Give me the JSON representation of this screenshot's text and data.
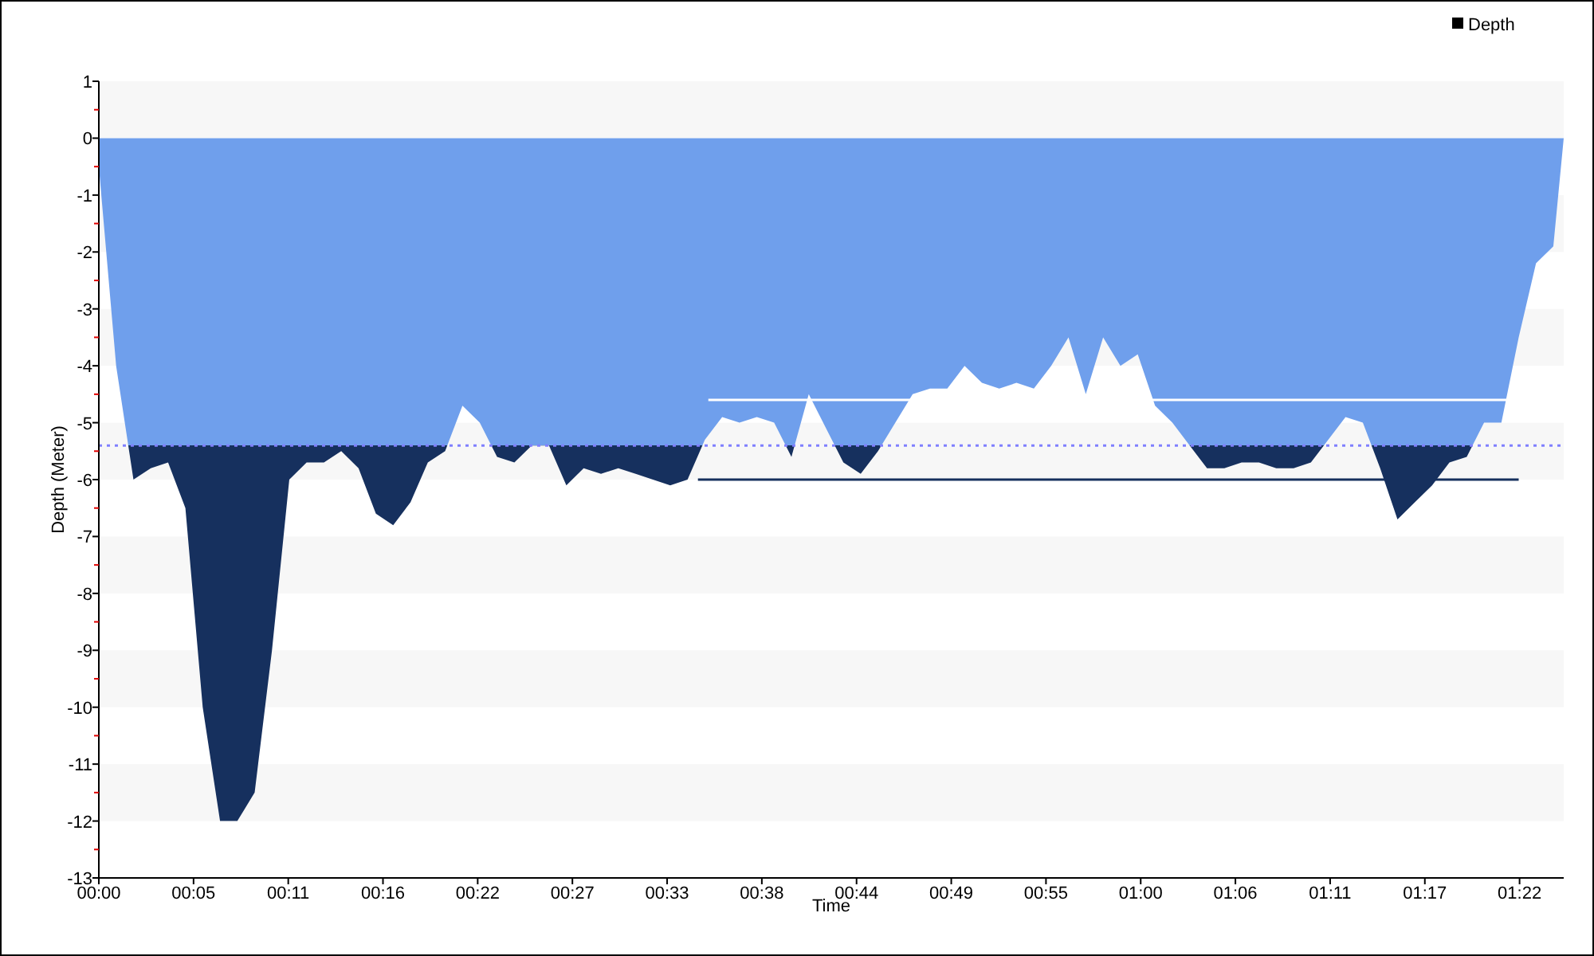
{
  "chart_data": {
    "type": "area",
    "xlabel": "Time",
    "ylabel": "Depth (Meter)",
    "xlim": [
      0,
      84.6
    ],
    "ylim": [
      -13,
      1
    ],
    "yticks": [
      1,
      0,
      -1,
      -2,
      -3,
      -4,
      -5,
      -6,
      -7,
      -8,
      -9,
      -10,
      -11,
      -12,
      -13
    ],
    "xticks": [
      {
        "value": 0,
        "label": "00:00"
      },
      {
        "value": 5.47,
        "label": "00:05"
      },
      {
        "value": 10.94,
        "label": "00:11"
      },
      {
        "value": 16.41,
        "label": "00:16"
      },
      {
        "value": 21.88,
        "label": "00:22"
      },
      {
        "value": 27.35,
        "label": "00:27"
      },
      {
        "value": 32.82,
        "label": "00:33"
      },
      {
        "value": 38.29,
        "label": "00:38"
      },
      {
        "value": 43.76,
        "label": "00:44"
      },
      {
        "value": 49.23,
        "label": "00:49"
      },
      {
        "value": 54.7,
        "label": "00:55"
      },
      {
        "value": 60.17,
        "label": "01:00"
      },
      {
        "value": 65.64,
        "label": "01:06"
      },
      {
        "value": 71.11,
        "label": "01:11"
      },
      {
        "value": 76.58,
        "label": "01:17"
      },
      {
        "value": 82.05,
        "label": "01:22"
      }
    ],
    "x": [
      0,
      1,
      2,
      3,
      4,
      5,
      6,
      7,
      8,
      9,
      10,
      11,
      12,
      13,
      14,
      15,
      16,
      17,
      18,
      19,
      20,
      21,
      22,
      23,
      24,
      25,
      26,
      27,
      28,
      29,
      30,
      31,
      32,
      33,
      34,
      35,
      36,
      37,
      38,
      39,
      40,
      41,
      42,
      43,
      44,
      45,
      46,
      47,
      48,
      49,
      50,
      51,
      52,
      53,
      54,
      55,
      56,
      57,
      58,
      59,
      60,
      61,
      62,
      63,
      64,
      65,
      66,
      67,
      68,
      69,
      70,
      71,
      72,
      73,
      74,
      75,
      76,
      77,
      78,
      79,
      80,
      81,
      82,
      83,
      84,
      84.6
    ],
    "series": [
      {
        "name": "Depth",
        "color": "#6f9fec",
        "values": [
          -0.5,
          -4,
          -6,
          -5.8,
          -5.7,
          -6.5,
          -10,
          -12,
          -12,
          -11.5,
          -9,
          -6,
          -5.7,
          -5.7,
          -5.5,
          -5.8,
          -6.6,
          -6.8,
          -6.4,
          -5.7,
          -5.5,
          -4.7,
          -5,
          -5.6,
          -5.7,
          -5.4,
          -5.4,
          -6.1,
          -5.8,
          -5.9,
          -5.8,
          -5.9,
          -6,
          -6.1,
          -6,
          -5.3,
          -4.9,
          -5,
          -4.9,
          -5,
          -5.6,
          -4.5,
          -5.1,
          -5.7,
          -5.9,
          -5.5,
          -5,
          -4.5,
          -4.4,
          -4.4,
          -4,
          -4.3,
          -4.4,
          -4.3,
          -4.4,
          -4,
          -3.5,
          -4.5,
          -3.5,
          -4,
          -3.8,
          -4.7,
          -5,
          -5.4,
          -5.8,
          -5.8,
          -5.7,
          -5.7,
          -5.8,
          -5.8,
          -5.7,
          -5.3,
          -4.9,
          -5,
          -5.8,
          -6.7,
          -6.4,
          -6.1,
          -5.7,
          -5.6,
          -5,
          -5,
          -3.5,
          -2.2,
          -1.9,
          0
        ]
      }
    ],
    "ref_lines": [
      {
        "axis": "y",
        "value": -5.4
      },
      {
        "axis": "y",
        "value": -4.6
      },
      {
        "axis": "y",
        "value": -6.0
      }
    ]
  }
}
